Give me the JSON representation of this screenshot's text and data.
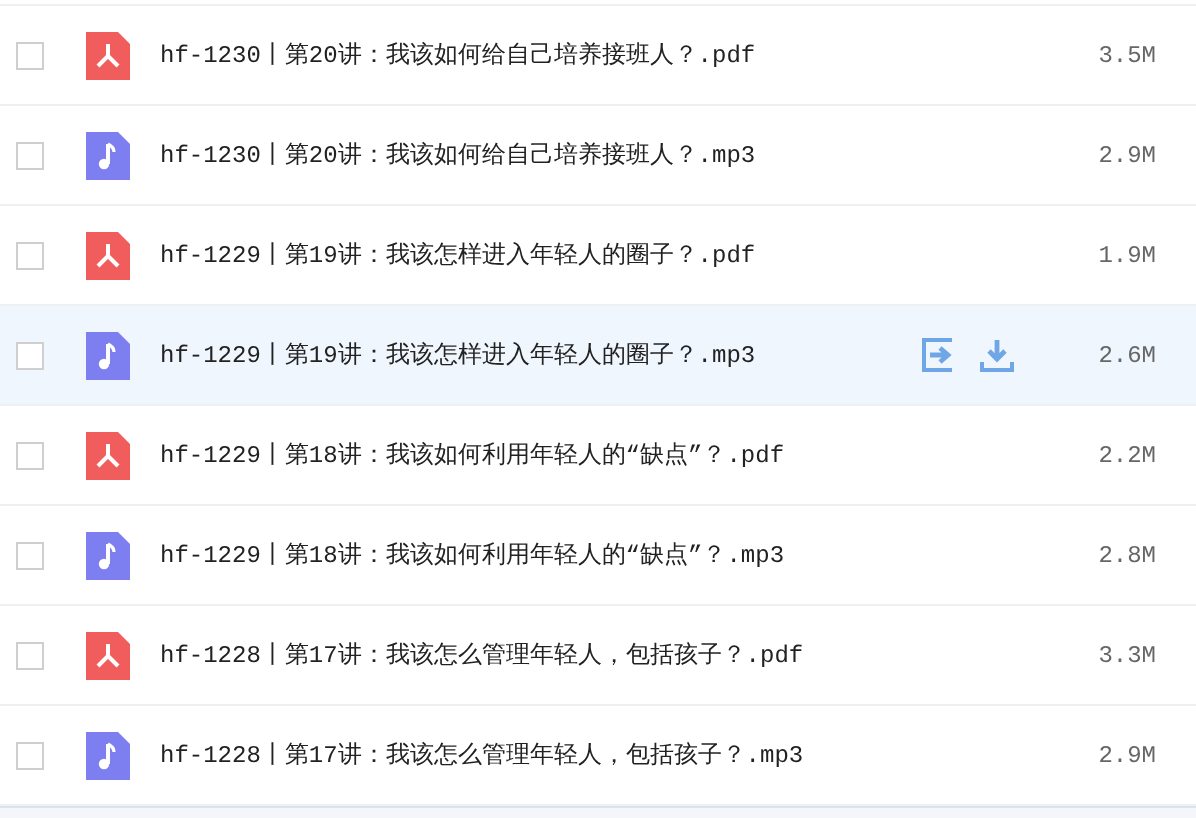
{
  "files": [
    {
      "kind": "pdf",
      "name": "hf-1230丨第20讲：我该如何给自己培养接班人？.pdf",
      "size": "3.5M",
      "checked": false,
      "highlighted": false
    },
    {
      "kind": "audio",
      "name": "hf-1230丨第20讲：我该如何给自己培养接班人？.mp3",
      "size": "2.9M",
      "checked": false,
      "highlighted": false
    },
    {
      "kind": "pdf",
      "name": "hf-1229丨第19讲：我该怎样进入年轻人的圈子？.pdf",
      "size": "1.9M",
      "checked": false,
      "highlighted": false
    },
    {
      "kind": "audio",
      "name": "hf-1229丨第19讲：我该怎样进入年轻人的圈子？.mp3",
      "size": "2.6M",
      "checked": false,
      "highlighted": true
    },
    {
      "kind": "pdf",
      "name": "hf-1229丨第18讲：我该如何利用年轻人的“缺点”？.pdf",
      "size": "2.2M",
      "checked": false,
      "highlighted": false
    },
    {
      "kind": "audio",
      "name": "hf-1229丨第18讲：我该如何利用年轻人的“缺点”？.mp3",
      "size": "2.8M",
      "checked": false,
      "highlighted": false
    },
    {
      "kind": "pdf",
      "name": "hf-1228丨第17讲：我该怎么管理年轻人，包括孩子？.pdf",
      "size": "3.3M",
      "checked": false,
      "highlighted": false
    },
    {
      "kind": "audio",
      "name": "hf-1228丨第17讲：我该怎么管理年轻人，包括孩子？.mp3",
      "size": "2.9M",
      "checked": false,
      "highlighted": false
    }
  ]
}
